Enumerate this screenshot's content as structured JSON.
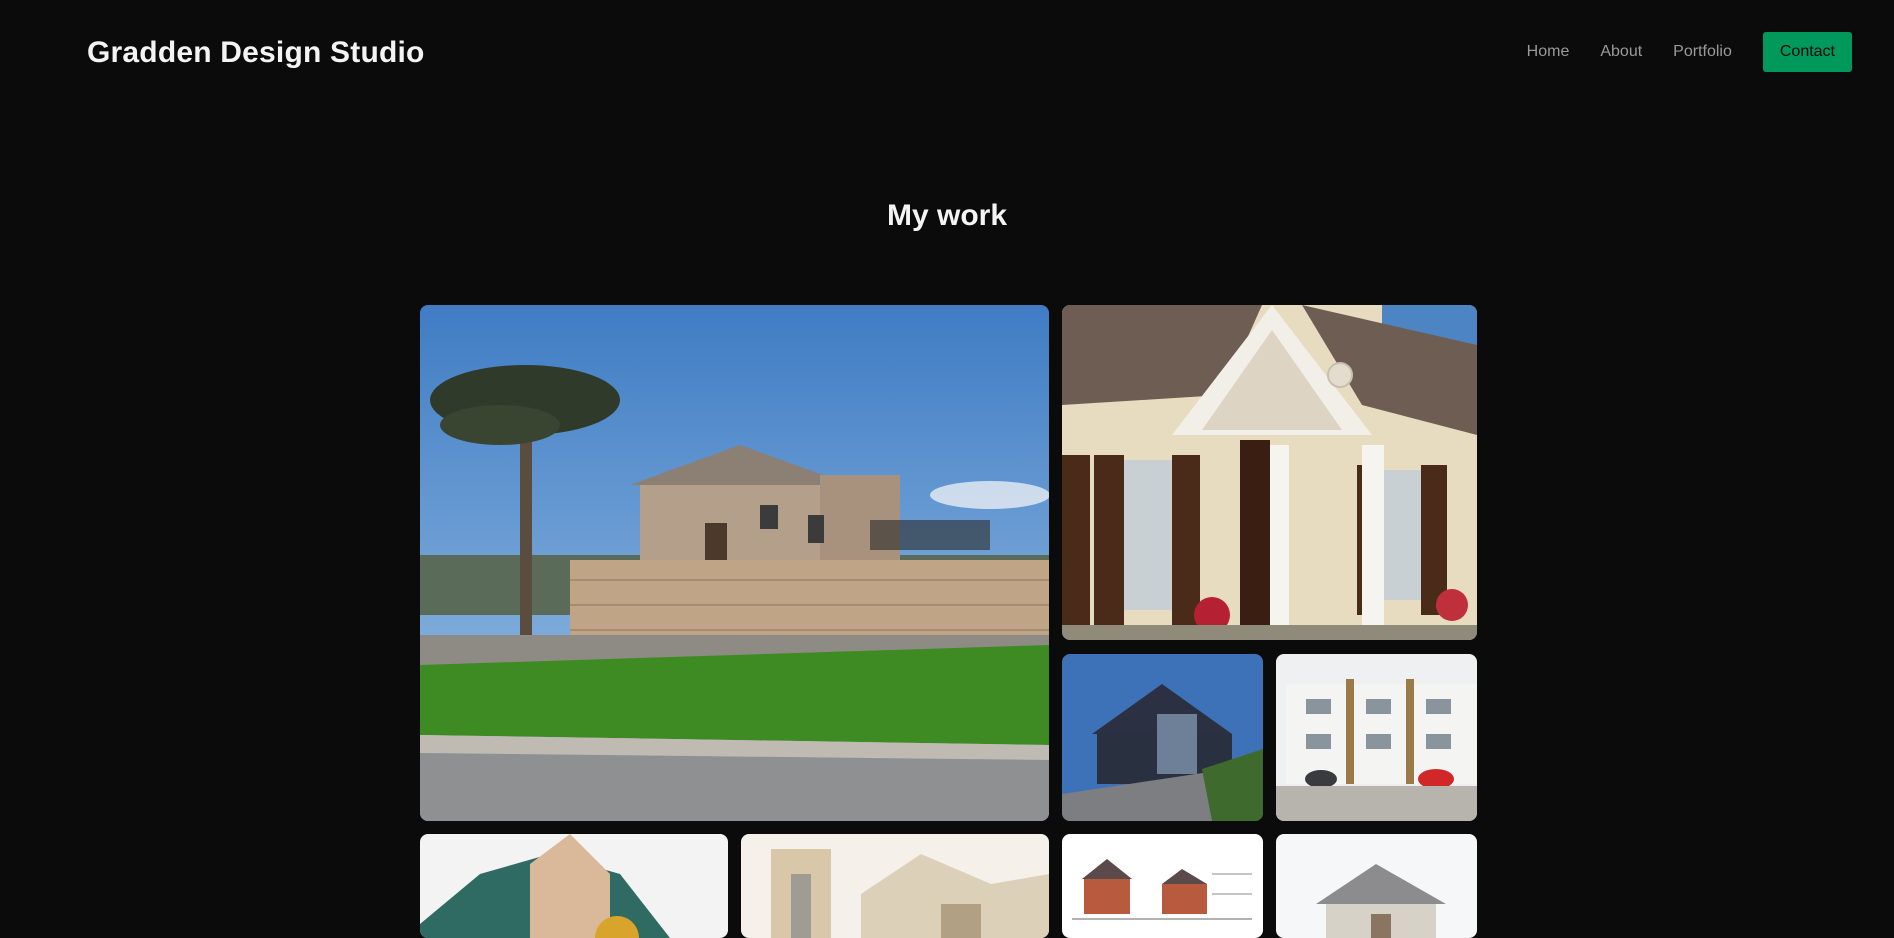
{
  "header": {
    "brand": "Gradden Design Studio",
    "nav": [
      {
        "label": "Home"
      },
      {
        "label": "About"
      },
      {
        "label": "Portfolio"
      }
    ],
    "contact_label": "Contact"
  },
  "main": {
    "heading": "My work"
  },
  "colors": {
    "background": "#0b0b0b",
    "accent": "#00995c",
    "nav_text": "#9a9a9a",
    "heading_text": "#f4f4f4"
  },
  "gallery": [
    {
      "name": "villa-palm-tree-photo"
    },
    {
      "name": "portico-columns-photo"
    },
    {
      "name": "glass-extension-photo"
    },
    {
      "name": "townhouse-terrace-photo"
    },
    {
      "name": "gabled-roof-photo"
    },
    {
      "name": "watercolour-facade-image"
    },
    {
      "name": "architectural-plans-image"
    },
    {
      "name": "house-render-image"
    }
  ]
}
